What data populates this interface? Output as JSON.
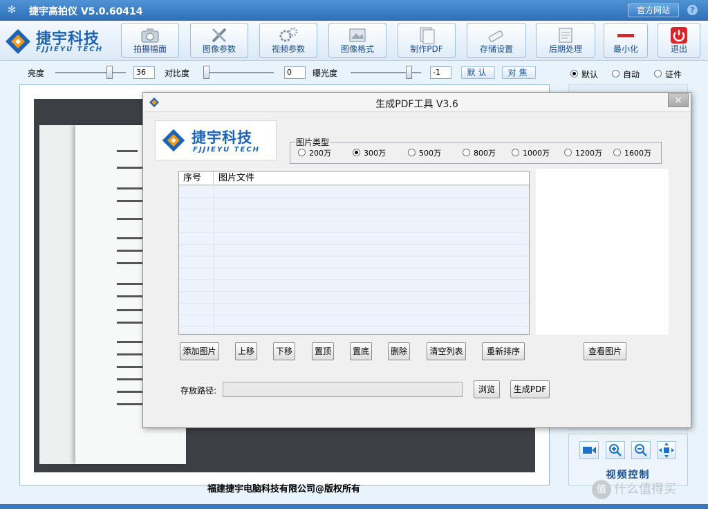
{
  "window": {
    "title": "捷宇高拍仪 V5.0.60414",
    "website_button": "官方网站",
    "help_icon": "help-icon"
  },
  "brand": {
    "name_cn": "捷宇科技",
    "name_en": "FJJIEYU TECH",
    "colors": {
      "blue": "#1d63b4",
      "orange": "#f39a1e"
    }
  },
  "toolbar": {
    "buttons": [
      {
        "label": "拍摄幅面",
        "icon": "camera-icon"
      },
      {
        "label": "图像参数",
        "icon": "tools-icon"
      },
      {
        "label": "视频参数",
        "icon": "gears-icon"
      },
      {
        "label": "图像格式",
        "icon": "image-format-icon"
      },
      {
        "label": "制作PDF",
        "icon": "pdf-pages-icon"
      },
      {
        "label": "存储设置",
        "icon": "usb-drive-icon"
      },
      {
        "label": "后期处理",
        "icon": "notepad-icon"
      },
      {
        "label": "最小化",
        "icon": "minimize-icon"
      },
      {
        "label": "退出",
        "icon": "power-icon"
      }
    ]
  },
  "adjust": {
    "brightness_label": "亮度",
    "brightness_value": "36",
    "contrast_label": "对比度",
    "contrast_value": "0",
    "exposure_label": "曝光度",
    "exposure_value": "-1",
    "default_button": "默认",
    "focus_button": "对焦",
    "modes": [
      {
        "label": "默认",
        "selected": true
      },
      {
        "label": "自动",
        "selected": false
      },
      {
        "label": "证件",
        "selected": false
      }
    ]
  },
  "video_control": {
    "label": "视频控制",
    "buttons": [
      "video-camera-icon",
      "zoom-in-icon",
      "zoom-out-icon",
      "fit-screen-icon"
    ]
  },
  "footer": {
    "copyright": "福建捷宇电脑科技有限公司@版权所有",
    "watermark": "什么值得买"
  },
  "dialog": {
    "title": "生成PDF工具 V3.6",
    "close": "×",
    "image_type_label": "图片类型",
    "image_types": [
      {
        "label": "200万",
        "selected": false
      },
      {
        "label": "300万",
        "selected": true
      },
      {
        "label": "500万",
        "selected": false
      },
      {
        "label": "800万",
        "selected": false
      },
      {
        "label": "1000万",
        "selected": false
      },
      {
        "label": "1200万",
        "selected": false
      },
      {
        "label": "1600万",
        "selected": false
      }
    ],
    "list_columns": [
      "序号",
      "图片文件"
    ],
    "list_rows": [],
    "buttons": [
      "添加图片",
      "上移",
      "下移",
      "置顶",
      "置底",
      "删除",
      "清空列表",
      "重新排序"
    ],
    "view_image_button": "查看图片",
    "path_label": "存放路径:",
    "path_value": "",
    "browse_button": "浏览",
    "generate_button": "生成PDF"
  }
}
